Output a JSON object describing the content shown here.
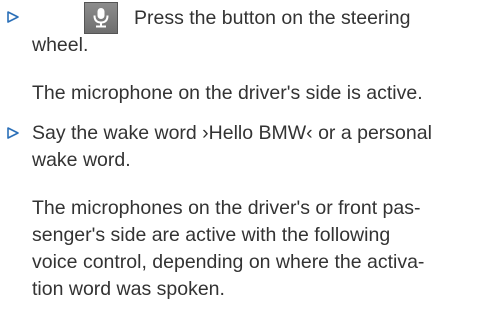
{
  "steps": [
    {
      "icon": "microphone-button-icon",
      "text_line1": "Press the button on the steering",
      "text_line2": "wheel.",
      "result": "The microphone on the driver's side is active."
    },
    {
      "text_line1": "Say the wake word ›Hello BMW‹ or a personal",
      "text_line2": "wake word.",
      "result_lines": [
        "The microphones on the driver's or front pas-",
        "senger's side are active with the following",
        "voice control, depending on where the activa-",
        "tion word was spoken."
      ]
    }
  ],
  "colors": {
    "text": "#333333",
    "bullet": "#2a6fb8",
    "button": "#7d7d7d"
  }
}
